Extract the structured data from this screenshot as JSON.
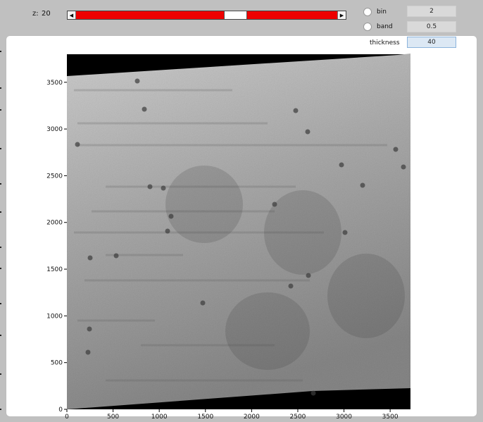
{
  "controls": {
    "z_label": "z:",
    "z_value": "20",
    "slider_fraction": 0.66,
    "bin_label": "bin",
    "bin_value": "2",
    "band_label": "band",
    "band_value": "0.5",
    "thickness_label": "thickness",
    "thickness_value": "40"
  },
  "chart_data": {
    "type": "heatmap",
    "title": "",
    "xlabel": "",
    "ylabel": "",
    "xlim": [
      0,
      3720
    ],
    "ylim": [
      0,
      3800
    ],
    "x_ticks": [
      "0",
      "500",
      "1000",
      "1500",
      "2000",
      "2500",
      "3000",
      "3500"
    ],
    "y_ticks": [
      "0",
      "500",
      "1000",
      "1500",
      "2000",
      "2500",
      "3000",
      "3500"
    ],
    "colormap": "gray",
    "background_color": "#000000"
  }
}
